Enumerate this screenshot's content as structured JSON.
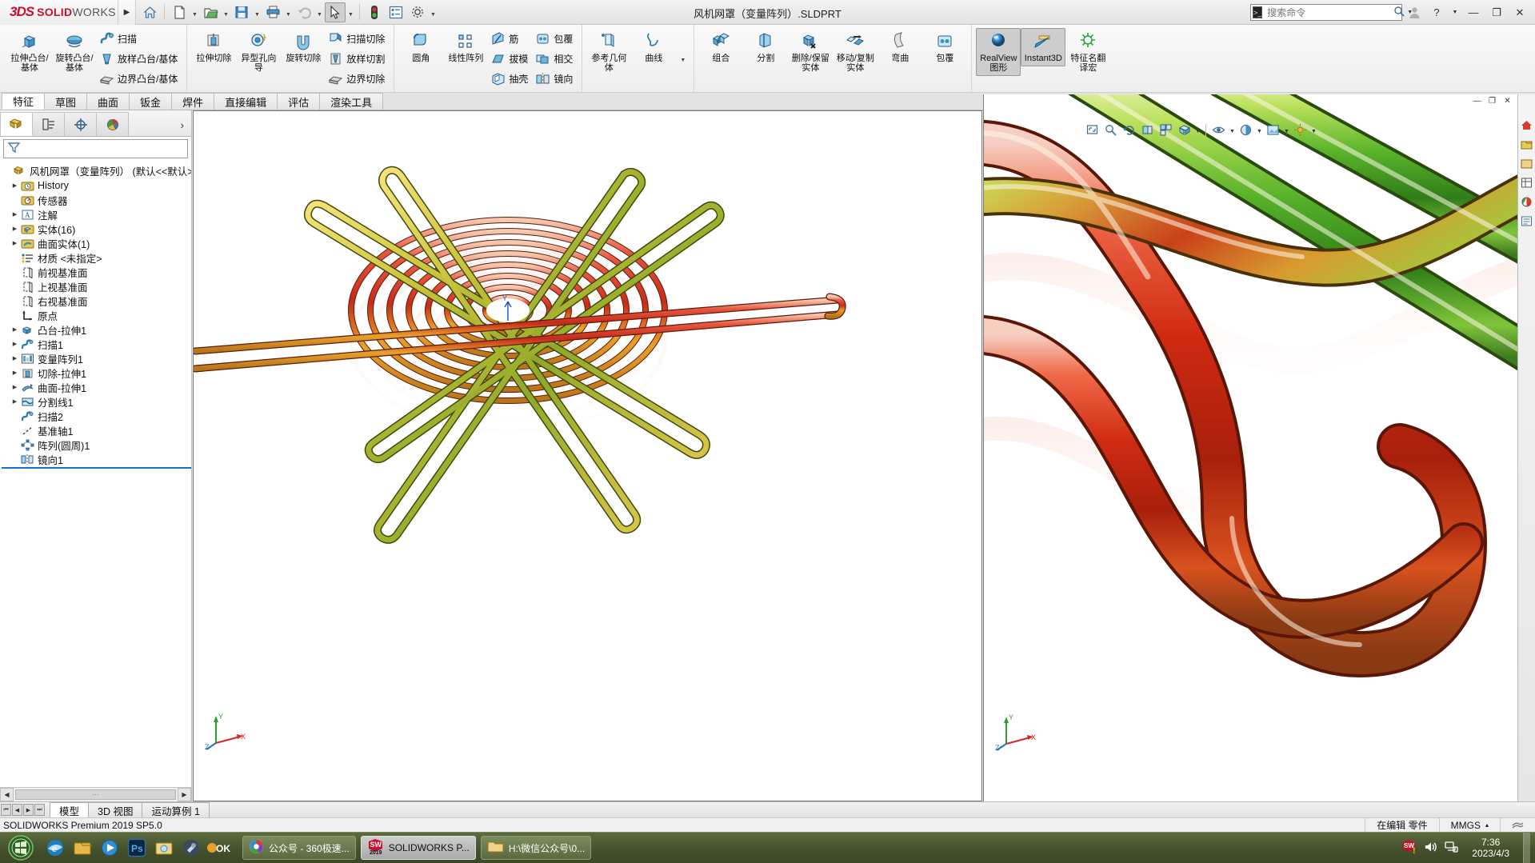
{
  "app": {
    "brand_ds": "3DS",
    "brand_bold": "SOLID",
    "brand_light": "WORKS",
    "document_title": "风机网罩（变量阵列）.SLDPRT",
    "version_status": "SOLIDWORKS Premium 2019 SP5.0",
    "accent": "#c8102e",
    "select_blue": "#cde8ff"
  },
  "quick_access": {
    "items": [
      {
        "name": "home-icon",
        "glyph": "⌂",
        "caret": false
      },
      {
        "name": "new-document-icon",
        "glyph": "🗋",
        "caret": true
      },
      {
        "name": "open-folder-icon",
        "glyph": "📂",
        "caret": true
      },
      {
        "name": "save-icon",
        "glyph": "💾",
        "caret": true
      },
      {
        "name": "print-icon",
        "glyph": "🖨",
        "caret": true
      },
      {
        "name": "undo-icon",
        "glyph": "↶",
        "caret": true
      },
      {
        "name": "select-cursor-icon",
        "glyph": "➤",
        "caret": true
      },
      {
        "name": "rebuild-traffic-light-icon",
        "glyph": "●",
        "caret": false
      },
      {
        "name": "properties-icon",
        "glyph": "▤",
        "caret": false
      },
      {
        "name": "options-gear-icon",
        "glyph": "⚙",
        "caret": true
      }
    ]
  },
  "search": {
    "placeholder": "搜索命令",
    "icon": "search-icon"
  },
  "title_right": {
    "user_icon": "user-account-icon",
    "help_label": "?",
    "minimize": "—",
    "restore": "❐",
    "close": "✕"
  },
  "ribbon": {
    "groups": [
      {
        "name": "boss-base-group",
        "big": [
          {
            "label": "拉伸凸台/基体",
            "icon": "extrude-boss-icon"
          },
          {
            "label": "旋转凸台/基体",
            "icon": "revolve-boss-icon"
          }
        ],
        "small": [
          {
            "label": "扫描",
            "icon": "sweep-icon"
          },
          {
            "label": "放样凸台/基体",
            "icon": "loft-boss-icon"
          },
          {
            "label": "边界凸台/基体",
            "icon": "boundary-boss-icon"
          }
        ]
      },
      {
        "name": "cut-group",
        "big": [
          {
            "label": "拉伸切除",
            "icon": "extrude-cut-icon"
          },
          {
            "label": "异型孔向导",
            "icon": "hole-wizard-icon"
          },
          {
            "label": "旋转切除",
            "icon": "revolve-cut-icon"
          }
        ],
        "small": [
          {
            "label": "扫描切除",
            "icon": "sweep-cut-icon"
          },
          {
            "label": "放样切割",
            "icon": "loft-cut-icon"
          },
          {
            "label": "边界切除",
            "icon": "boundary-cut-icon"
          }
        ]
      },
      {
        "name": "feature-group",
        "big": [
          {
            "label": "圆角",
            "icon": "fillet-icon"
          },
          {
            "label": "线性阵列",
            "icon": "linear-pattern-icon"
          }
        ],
        "small": [
          {
            "label": "筋",
            "icon": "rib-icon"
          },
          {
            "label": "拔模",
            "icon": "draft-icon"
          },
          {
            "label": "抽壳",
            "icon": "shell-icon"
          }
        ],
        "small2": [
          {
            "label": "包覆",
            "icon": "wrap-icon"
          },
          {
            "label": "相交",
            "icon": "intersect-icon"
          },
          {
            "label": "镜向",
            "icon": "mirror-icon"
          }
        ]
      },
      {
        "name": "reference-group",
        "big": [
          {
            "label": "参考几何体",
            "icon": "reference-geometry-icon"
          },
          {
            "label": "曲线",
            "icon": "curves-icon"
          }
        ]
      },
      {
        "name": "bodies-group",
        "big": [
          {
            "label": "组合",
            "icon": "combine-icon"
          },
          {
            "label": "分割",
            "icon": "split-icon"
          },
          {
            "label": "删除/保留实体",
            "icon": "delete-keep-body-icon"
          },
          {
            "label": "移动/复制实体",
            "icon": "move-copy-body-icon"
          },
          {
            "label": "弯曲",
            "icon": "flex-icon"
          },
          {
            "label": "包覆",
            "icon": "wrap2-icon"
          }
        ]
      },
      {
        "name": "display-group",
        "big": [
          {
            "label": "RealView 图形",
            "icon": "realview-sphere-icon",
            "active": true
          },
          {
            "label": "Instant3D",
            "icon": "instant3d-icon",
            "active": true
          },
          {
            "label": "特征名翻译宏",
            "icon": "feature-translate-macro-icon"
          }
        ]
      }
    ]
  },
  "tabs": {
    "items": [
      "特征",
      "草图",
      "曲面",
      "钣金",
      "焊件",
      "直接编辑",
      "评估",
      "渲染工具"
    ],
    "selected_index": 0
  },
  "feature_manager": {
    "tabs": [
      {
        "name": "feature-tree-tab",
        "icon": "feature-tree-icon",
        "selected": true
      },
      {
        "name": "property-manager-tab",
        "icon": "property-manager-icon",
        "selected": false
      },
      {
        "name": "configuration-manager-tab",
        "icon": "configuration-icon",
        "selected": false
      },
      {
        "name": "display-manager-tab",
        "icon": "display-manager-icon",
        "selected": false
      }
    ],
    "more_glyph": "›",
    "filter_icon": "filter-funnel-icon",
    "root": "风机网罩（变量阵列）  (默认<<默认>_",
    "items": [
      {
        "label": "History",
        "icon": "history-icon",
        "expand": true,
        "indent": 1
      },
      {
        "label": "传感器",
        "icon": "sensors-icon",
        "expand": false,
        "indent": 1
      },
      {
        "label": "注解",
        "icon": "annotations-icon",
        "expand": true,
        "indent": 1
      },
      {
        "label": "实体(16)",
        "icon": "solid-bodies-icon",
        "expand": true,
        "indent": 1
      },
      {
        "label": "曲面实体(1)",
        "icon": "surface-bodies-icon",
        "expand": true,
        "indent": 1
      },
      {
        "label": "材质 <未指定>",
        "icon": "material-icon",
        "expand": false,
        "indent": 1
      },
      {
        "label": "前视基准面",
        "icon": "plane-icon",
        "expand": false,
        "indent": 1
      },
      {
        "label": "上视基准面",
        "icon": "plane-icon",
        "expand": false,
        "indent": 1
      },
      {
        "label": "右视基准面",
        "icon": "plane-icon",
        "expand": false,
        "indent": 1
      },
      {
        "label": "原点",
        "icon": "origin-icon",
        "expand": false,
        "indent": 1
      },
      {
        "label": "凸台-拉伸1",
        "icon": "extrude-feature-icon",
        "expand": true,
        "indent": 1
      },
      {
        "label": "扫描1",
        "icon": "sweep-feature-icon",
        "expand": true,
        "indent": 1
      },
      {
        "label": "变量阵列1",
        "icon": "variable-pattern-icon",
        "expand": true,
        "indent": 1
      },
      {
        "label": "切除-拉伸1",
        "icon": "cut-extrude-feature-icon",
        "expand": true,
        "indent": 1
      },
      {
        "label": "曲面-拉伸1",
        "icon": "surface-extrude-icon",
        "expand": true,
        "indent": 1
      },
      {
        "label": "分割线1",
        "icon": "split-line-icon",
        "expand": true,
        "indent": 1
      },
      {
        "label": "扫描2",
        "icon": "sweep-feature-icon",
        "expand": false,
        "indent": 1
      },
      {
        "label": "基准轴1",
        "icon": "axis-icon",
        "expand": false,
        "indent": 1
      },
      {
        "label": "阵列(圆周)1",
        "icon": "circular-pattern-icon",
        "expand": false,
        "indent": 1
      },
      {
        "label": "镜向1",
        "icon": "mirror-feature-icon",
        "expand": false,
        "indent": 1
      }
    ]
  },
  "viewport_toolbar": {
    "items": [
      {
        "name": "zoom-to-fit-icon",
        "glyph": "⤢",
        "caret": false
      },
      {
        "name": "zoom-to-area-icon",
        "glyph": "⬚",
        "caret": false
      },
      {
        "name": "previous-view-icon",
        "glyph": "⟲",
        "caret": false
      },
      {
        "name": "section-view-icon",
        "glyph": "◧",
        "caret": false
      },
      {
        "name": "view-orientation-icon",
        "glyph": "◱",
        "caret": false
      },
      {
        "name": "display-style-icon",
        "glyph": "◼",
        "caret": true
      },
      {
        "name": "hide-show-items-icon",
        "glyph": "👁",
        "caret": true
      },
      {
        "name": "edit-appearance-icon",
        "glyph": "◉",
        "caret": true
      },
      {
        "name": "apply-scene-icon",
        "glyph": "▣",
        "caret": true
      },
      {
        "name": "view-settings-icon",
        "glyph": "☀",
        "caret": true
      }
    ]
  },
  "task_pane": {
    "items": [
      {
        "name": "solidworks-resources-icon",
        "glyph": "⌂"
      },
      {
        "name": "design-library-icon",
        "glyph": "🗂"
      },
      {
        "name": "file-explorer-icon",
        "glyph": "📁"
      },
      {
        "name": "view-palette-icon",
        "glyph": "▤"
      },
      {
        "name": "appearances-scenes-icon",
        "glyph": "◕"
      },
      {
        "name": "custom-properties-icon",
        "glyph": "▦"
      }
    ]
  },
  "bottom_tabs": {
    "nav": [
      "⏮",
      "◀",
      "▶",
      "⏭"
    ],
    "items": [
      "模型",
      "3D 视图",
      "运动算例 1"
    ],
    "selected_index": 0
  },
  "status_bar": {
    "left": "SOLIDWORKS Premium 2019 SP5.0",
    "editing": "在编辑 零件",
    "units": "MMGS",
    "units_caret": "▴",
    "overlay_icon": "sheet-icon"
  },
  "taskbar": {
    "start_icon": "start-orb-icon",
    "quick_launch": [
      {
        "name": "ie-icon",
        "glyph": "e"
      },
      {
        "name": "explorer-icon",
        "glyph": "📁"
      },
      {
        "name": "media-player-icon",
        "glyph": "▶"
      },
      {
        "name": "photoshop-icon",
        "glyph": "Ps"
      },
      {
        "name": "folder2-icon",
        "glyph": "📁"
      },
      {
        "name": "tool-icon",
        "glyph": "✎"
      },
      {
        "name": "ok-icon",
        "glyph": "OK"
      }
    ],
    "windows": [
      {
        "label": "公众号 - 360极速...",
        "icon": "chrome-icon",
        "active": false
      },
      {
        "label": "SOLIDWORKS P...",
        "icon": "solidworks-2019-icon",
        "active": true
      },
      {
        "label": "H:\\微信公众号\\0...",
        "icon": "folder-window-icon",
        "active": false
      }
    ],
    "tray": [
      {
        "name": "solidworks-tray-icon",
        "glyph": "SW"
      },
      {
        "name": "volume-icon",
        "glyph": "🔊"
      },
      {
        "name": "network-icon",
        "glyph": "🖧"
      }
    ],
    "clock_time": "7:36",
    "clock_date": "2023/4/3"
  }
}
